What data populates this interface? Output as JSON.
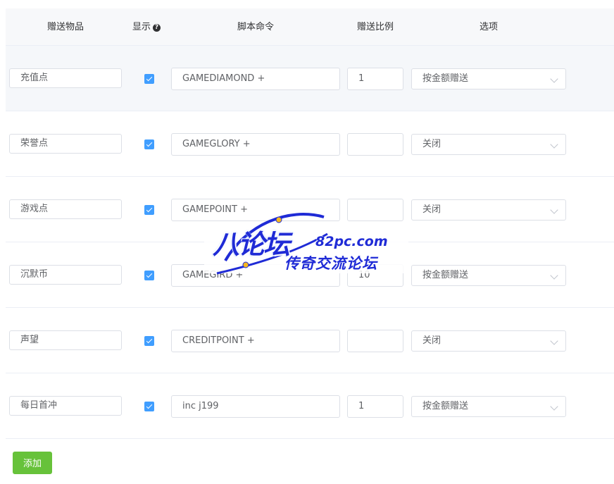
{
  "table": {
    "headers": {
      "item": "赠送物品",
      "show": "显示",
      "show_help_icon": "question-circle-icon",
      "command": "脚本命令",
      "ratio": "赠送比例",
      "option": "选项"
    },
    "rows": [
      {
        "item": "充值点",
        "show": true,
        "command": "GAMEDIAMOND +",
        "ratio": "1",
        "option": "按金额赠送",
        "highlighted": true
      },
      {
        "item": "荣誉点",
        "show": true,
        "command": "GAMEGLORY +",
        "ratio": "",
        "option": "关闭"
      },
      {
        "item": "游戏点",
        "show": true,
        "command": "GAMEPOINT +",
        "ratio": "",
        "option": "关闭"
      },
      {
        "item": "沉默币",
        "show": true,
        "command": "GAMEGIRD +",
        "ratio": "10",
        "option": "按金额赠送"
      },
      {
        "item": "声望",
        "show": true,
        "command": "CREDITPOINT +",
        "ratio": "",
        "option": "关闭"
      },
      {
        "item": "每日首冲",
        "show": true,
        "command": "inc j199",
        "ratio": "1",
        "option": "按金额赠送"
      }
    ]
  },
  "add_button": {
    "label": "添加"
  },
  "watermark": {
    "logo": "八论坛",
    "domain": "82pc.com",
    "tagline": "传奇交流论坛"
  },
  "colors": {
    "checkbox": "#409eff",
    "add_button": "#67c23a",
    "header_bg": "#f7f8fa",
    "row_highlight": "#f5f7fa",
    "watermark": "#1f2bd6"
  }
}
